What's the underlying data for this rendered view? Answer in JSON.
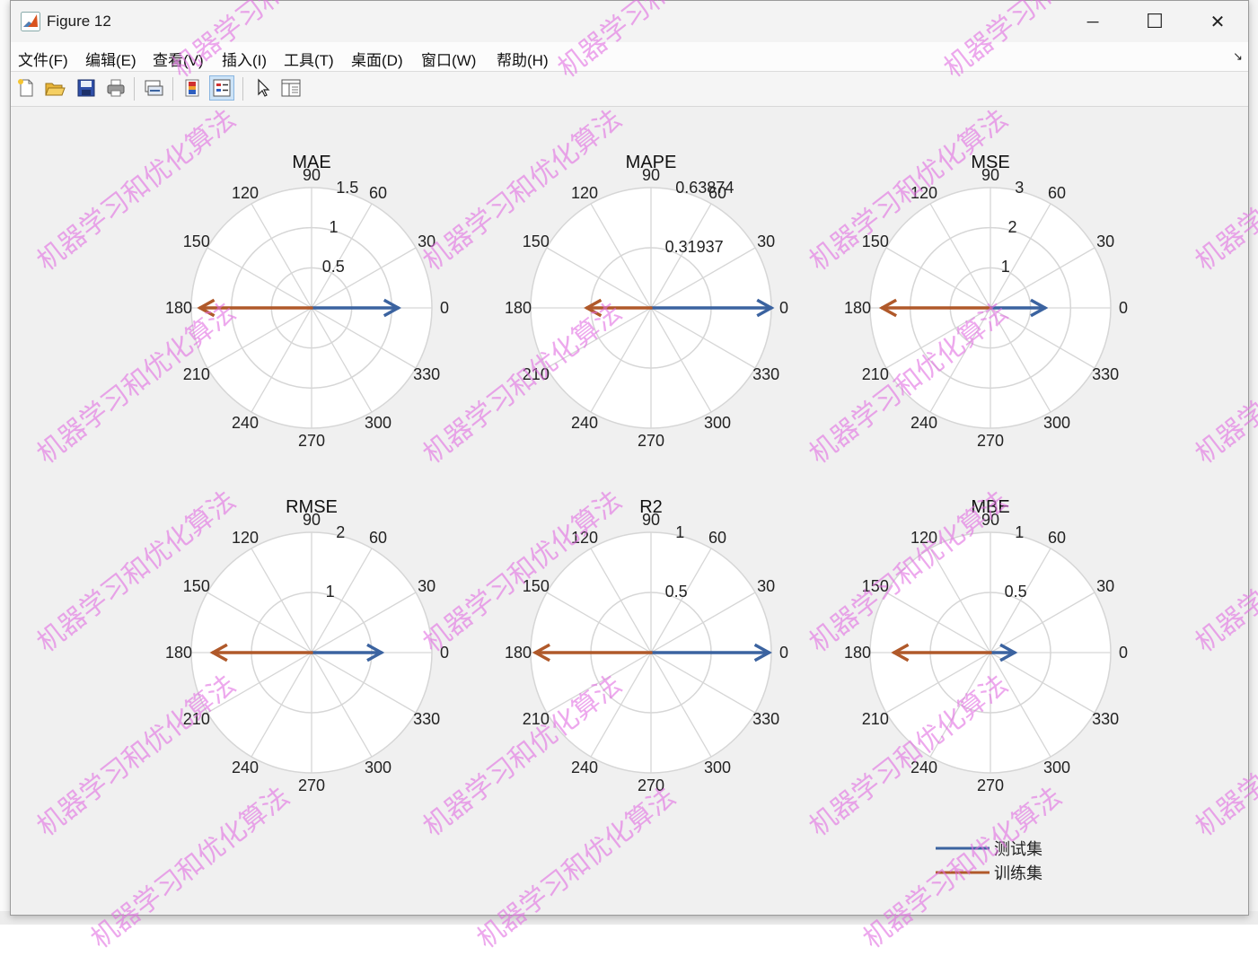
{
  "window": {
    "title": "Figure 12",
    "controls": {
      "minimize": "─",
      "maximize": "☐",
      "close": "✕"
    }
  },
  "menu": {
    "items": [
      "文件(F)",
      "编辑(E)",
      "查看(V)",
      "插入(I)",
      "工具(T)",
      "桌面(D)",
      "窗口(W)",
      "帮助(H)"
    ],
    "overflow_arrow": "↘"
  },
  "toolbar": {
    "icons": [
      "new-figure-icon",
      "open-file-icon",
      "save-icon",
      "print-icon",
      "link-plot-icon",
      "insert-colorbar-icon",
      "insert-legend-icon",
      "edit-plot-arrow-icon",
      "property-inspector-icon"
    ],
    "active": "insert-legend-icon"
  },
  "colors": {
    "test": "#3b63a0",
    "train": "#b0592a",
    "grid": "#d6d6d6",
    "axes_bg": "#ffffff",
    "figure_bg": "#f0f0f0"
  },
  "chart_data": [
    {
      "type": "polar",
      "title": "MAE",
      "theta_ticks": [
        "0",
        "30",
        "60",
        "90",
        "120",
        "150",
        "180",
        "210",
        "240",
        "270",
        "300",
        "330"
      ],
      "r_ticks": [
        "0.5",
        "1",
        "1.5"
      ],
      "r_max": 1.5,
      "series": [
        {
          "name": "测试集",
          "theta": 0,
          "r": 1.08
        },
        {
          "name": "训练集",
          "theta": 180,
          "r": 1.39
        }
      ]
    },
    {
      "type": "polar",
      "title": "MAPE",
      "theta_ticks": [
        "0",
        "30",
        "60",
        "90",
        "120",
        "150",
        "180",
        "210",
        "240",
        "270",
        "300",
        "330"
      ],
      "r_ticks": [
        "0.31937",
        "0.63874"
      ],
      "r_max": 0.63874,
      "series": [
        {
          "name": "测试集",
          "theta": 0,
          "r": 0.6387
        },
        {
          "name": "训练集",
          "theta": 180,
          "r": 0.34
        }
      ]
    },
    {
      "type": "polar",
      "title": "MSE",
      "theta_ticks": [
        "0",
        "30",
        "60",
        "90",
        "120",
        "150",
        "180",
        "210",
        "240",
        "270",
        "300",
        "330"
      ],
      "r_ticks": [
        "1",
        "2",
        "3"
      ],
      "r_max": 3,
      "series": [
        {
          "name": "测试集",
          "theta": 0,
          "r": 1.36
        },
        {
          "name": "训练集",
          "theta": 180,
          "r": 2.7
        }
      ]
    },
    {
      "type": "polar",
      "title": "RMSE",
      "theta_ticks": [
        "0",
        "30",
        "60",
        "90",
        "120",
        "150",
        "180",
        "210",
        "240",
        "270",
        "300",
        "330"
      ],
      "r_ticks": [
        "1",
        "2"
      ],
      "r_max": 2,
      "series": [
        {
          "name": "测试集",
          "theta": 0,
          "r": 1.16
        },
        {
          "name": "训练集",
          "theta": 180,
          "r": 1.64
        }
      ]
    },
    {
      "type": "polar",
      "title": "R2",
      "theta_ticks": [
        "0",
        "30",
        "60",
        "90",
        "120",
        "150",
        "180",
        "210",
        "240",
        "270",
        "300",
        "330"
      ],
      "r_ticks": [
        "0.5",
        "1"
      ],
      "r_max": 1,
      "series": [
        {
          "name": "测试集",
          "theta": 0,
          "r": 0.98
        },
        {
          "name": "训练集",
          "theta": 180,
          "r": 0.96
        }
      ]
    },
    {
      "type": "polar",
      "title": "MBE",
      "theta_ticks": [
        "0",
        "30",
        "60",
        "90",
        "120",
        "150",
        "180",
        "210",
        "240",
        "270",
        "300",
        "330"
      ],
      "r_ticks": [
        "0.5",
        "1"
      ],
      "r_max": 1,
      "series": [
        {
          "name": "测试集",
          "theta": 0,
          "r": 0.2
        },
        {
          "name": "训练集",
          "theta": 180,
          "r": 0.8
        }
      ]
    }
  ],
  "legend": {
    "position": "bottom-right",
    "entries": [
      {
        "label": "测试集"
      },
      {
        "label": "训练集"
      }
    ]
  },
  "watermark": {
    "text": "机器学习和优化算法"
  }
}
